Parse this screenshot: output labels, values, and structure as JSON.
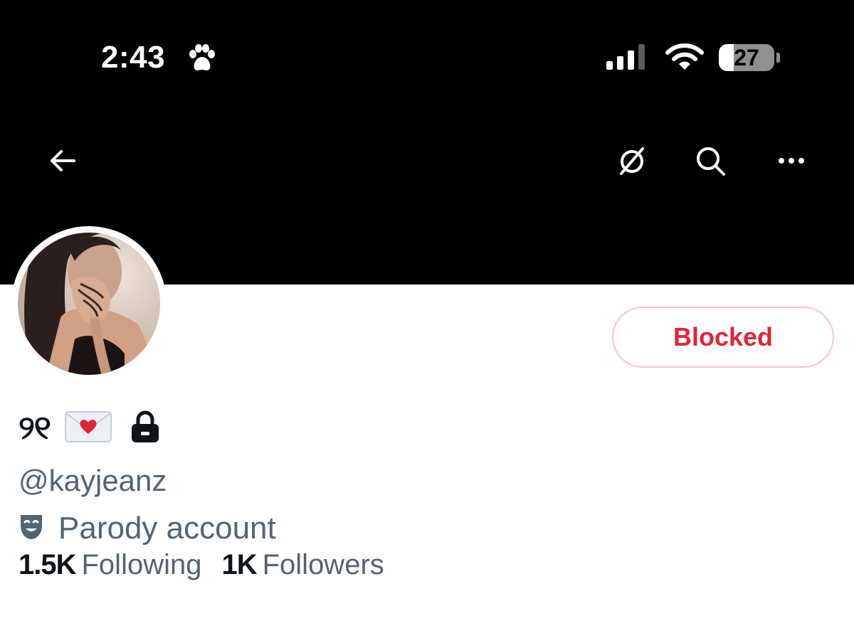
{
  "status_bar": {
    "time": "2:43",
    "battery_level": "27",
    "battery_fraction": 0.27,
    "signal_bars_active": 3,
    "signal_bars_total": 4
  },
  "nav": {
    "back_icon": "arrow-left-icon",
    "grok_icon": "grok-slash-circle-icon",
    "search_icon": "search-icon",
    "more_icon": "more-horizontal-icon"
  },
  "profile": {
    "display_name": "୨୧",
    "name_emoji": "love-letter-icon",
    "protected_icon": "lock-icon",
    "handle": "@kayjeanz",
    "label_icon": "theater-mask-icon",
    "label_text": "Parody account",
    "following_count": "1.5K",
    "following_label": "Following",
    "followers_count": "1K",
    "followers_label": "Followers"
  },
  "actions": {
    "blocked_label": "Blocked"
  },
  "colors": {
    "banner": "#000000",
    "blocked_red": "#e2243a",
    "secondary_text": "#536471",
    "primary_text": "#0f1419"
  }
}
